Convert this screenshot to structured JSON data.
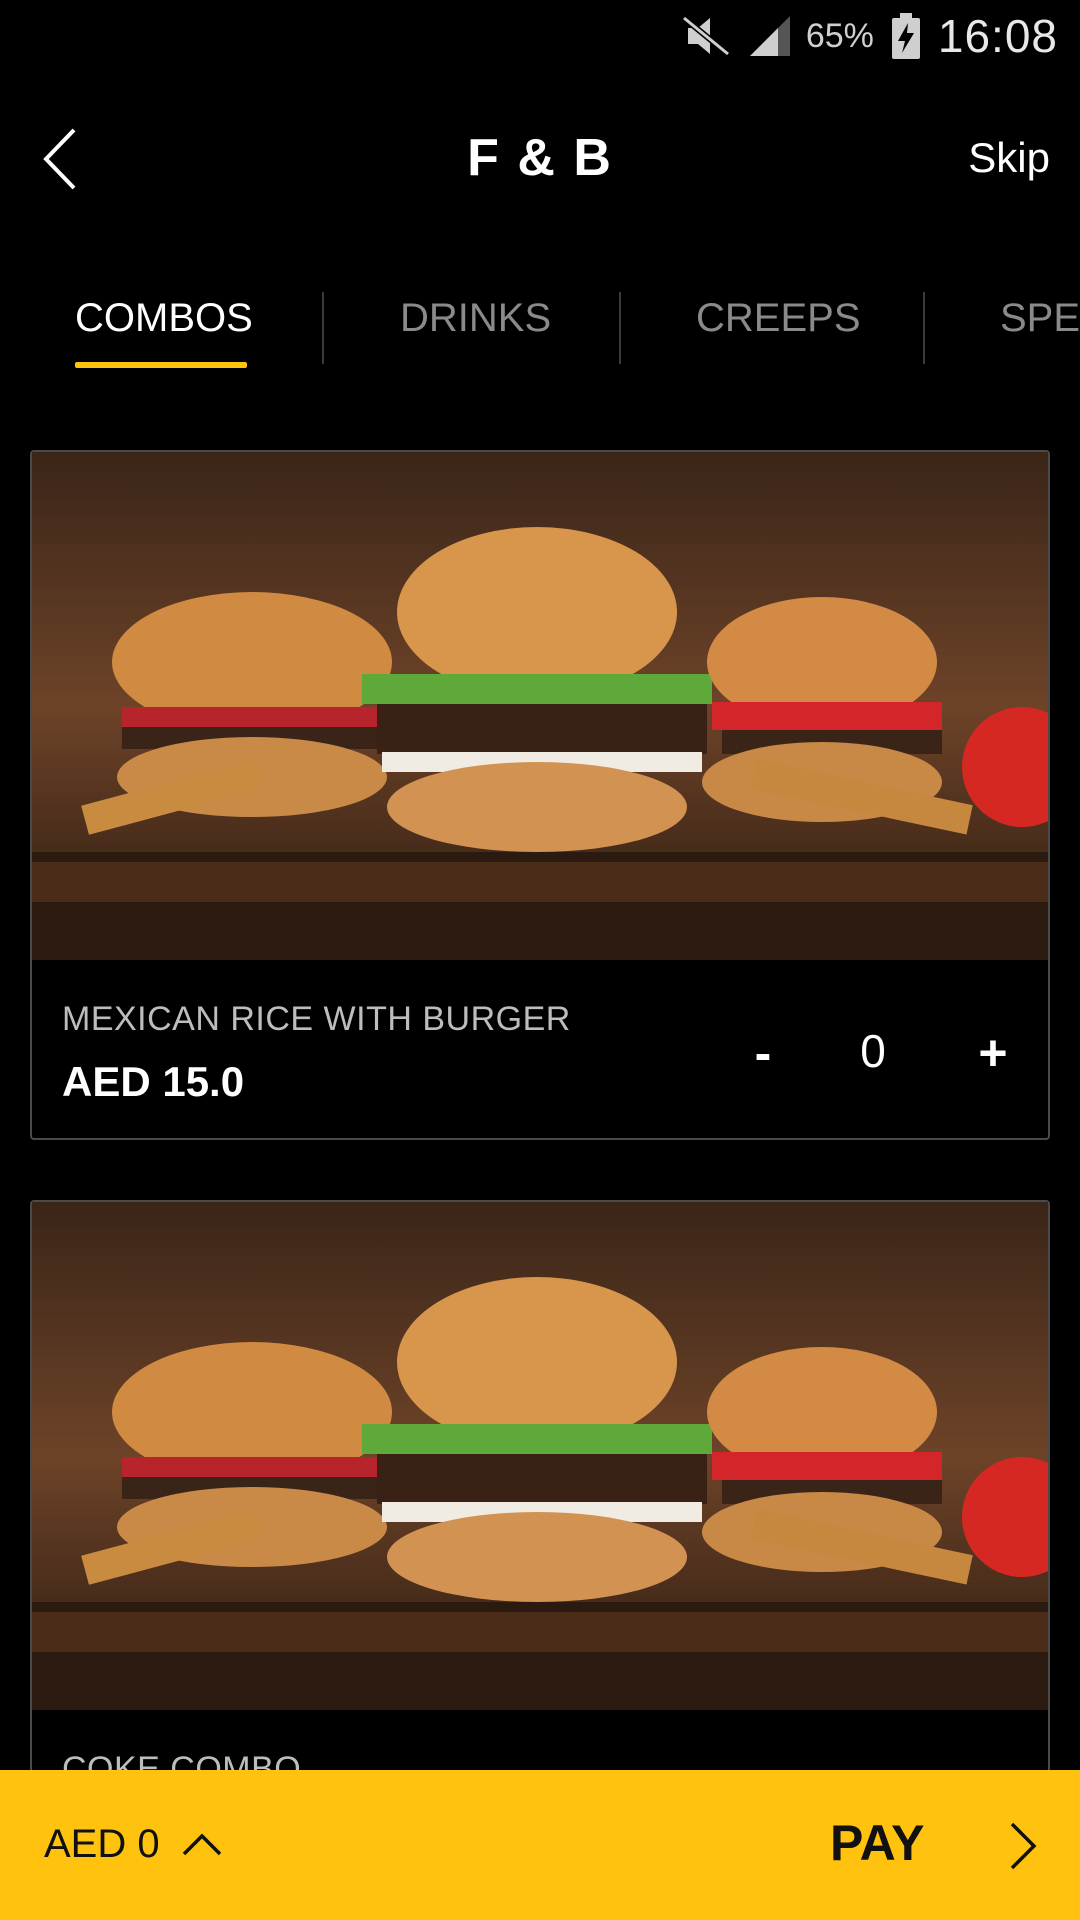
{
  "status_bar": {
    "battery_percent": "65%",
    "time": "16:08",
    "icons": [
      "mute-icon",
      "signal-icon",
      "battery-charging-icon"
    ]
  },
  "header": {
    "title": "F & B",
    "skip_label": "Skip",
    "back_icon": "chevron-left-icon"
  },
  "tabs": [
    {
      "label": "COMBOS",
      "active": true
    },
    {
      "label": "DRINKS",
      "active": false
    },
    {
      "label": "CREEPS",
      "active": false
    },
    {
      "label": "SPEC",
      "active": false
    }
  ],
  "items": [
    {
      "name": "MEXICAN RICE WITH BURGER",
      "price": "AED 15.0",
      "quantity": "0",
      "minus": "-",
      "plus": "+"
    },
    {
      "name": "COKE COMBO"
    }
  ],
  "bottom_bar": {
    "total": "AED 0",
    "pay_label": "PAY",
    "accent_color": "#ffc20e"
  }
}
